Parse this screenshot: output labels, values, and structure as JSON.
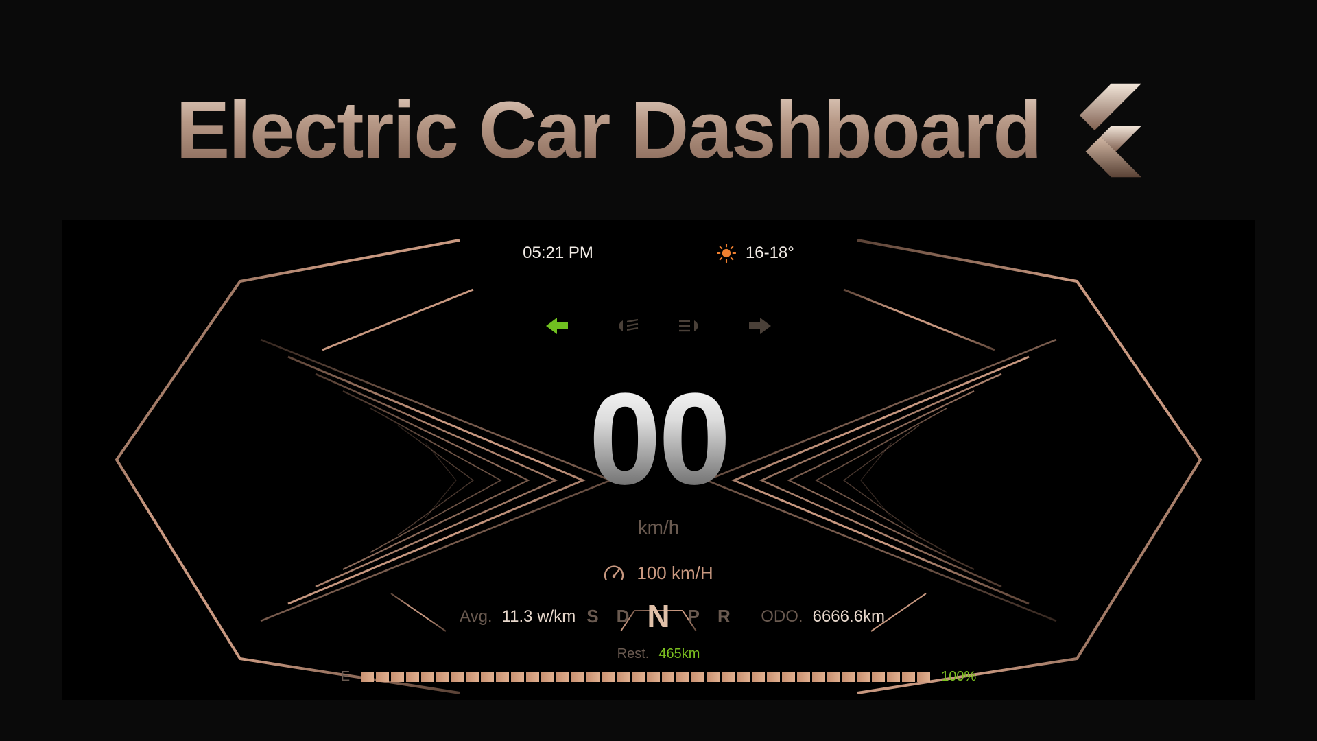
{
  "title": "Electric Car Dashboard",
  "clock": "05:21 PM",
  "temperature": "16-18°",
  "speed": {
    "value": "00",
    "unit": "km/h"
  },
  "cruise_speed": "100 km/H",
  "gears": {
    "s": "S",
    "d": "D",
    "n": "N",
    "p": "P",
    "r": "R"
  },
  "avg_consumption": {
    "label": "Avg.",
    "value": "11.3 w/km"
  },
  "odometer": {
    "label": "ODO.",
    "value": "6666.6km"
  },
  "range": {
    "label": "Rest.",
    "value": "465km"
  },
  "battery": {
    "empty_label": "E",
    "percent": "100%"
  },
  "colors": {
    "accent": "#c89880",
    "green": "#7cc020"
  }
}
